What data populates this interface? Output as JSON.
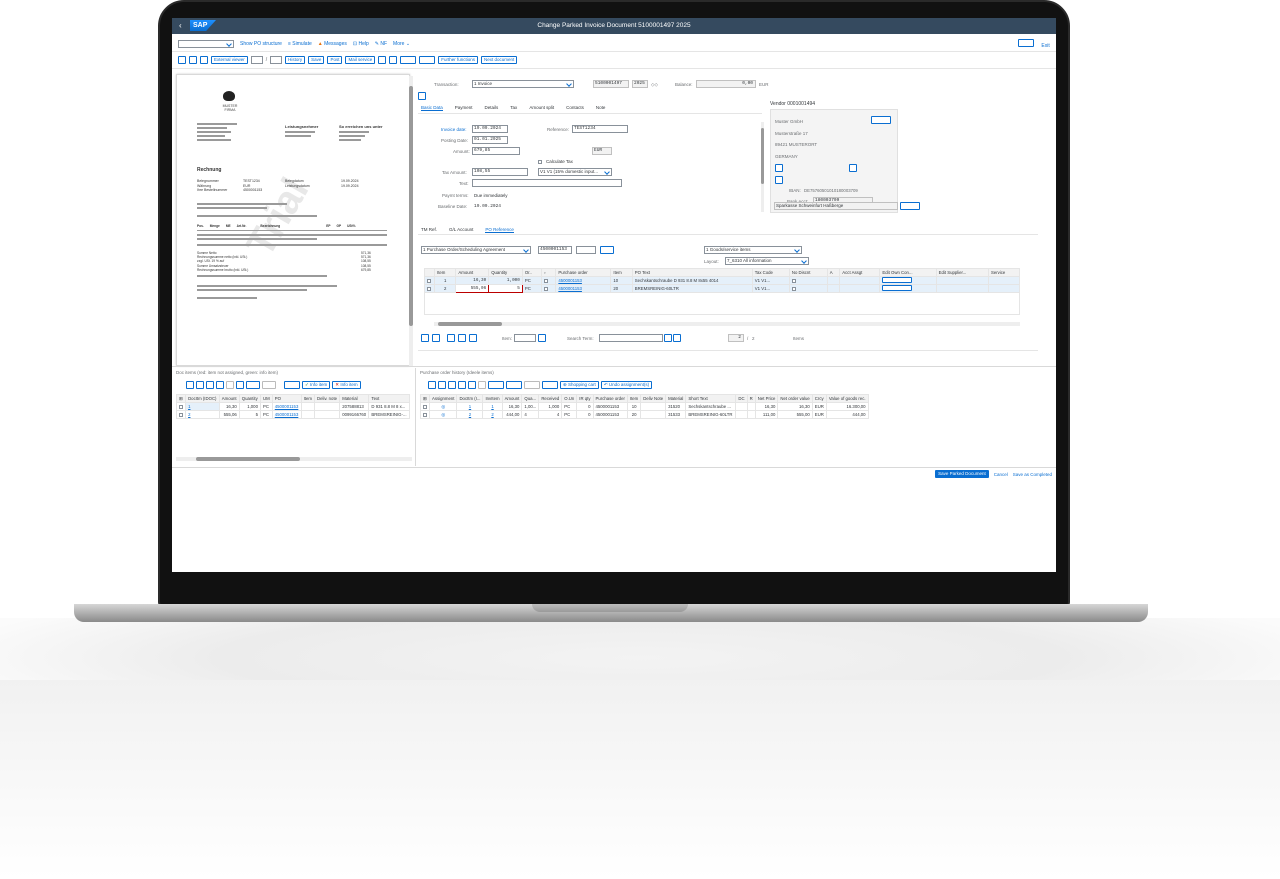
{
  "window": {
    "title": "Change Parked Invoice Document 5100001497 2025",
    "logo": "SAP",
    "exit_label": "Exit"
  },
  "toolbar1": {
    "show_po_structure": "Show PO structure",
    "simulate": "Simulate",
    "messages": "Messages",
    "help": "Help",
    "nf": "NF",
    "more": "More"
  },
  "toolbar2": {
    "external_viewer": "External viewer",
    "history": "History",
    "save": "Save",
    "post": "Post",
    "mail_service": "Mail service",
    "further_functions": "Further functions",
    "next_document": "Next document"
  },
  "pdf": {
    "company_line1": "MUSTER",
    "company_line2": "FIRMA",
    "watermark": "Trial",
    "heading": "Rechnung",
    "recipient_head": "Leistungsnehmer",
    "address_head": "So erreichen uns unter",
    "meta_labels": [
      "Belegnummer",
      "Währung",
      "Ihre Bestellnummer"
    ],
    "meta_values": [
      "TEST1234",
      "EUR",
      "4500001153"
    ],
    "date_labels": [
      "Belegdatum",
      "Leistungsdatum"
    ],
    "date_values": [
      "19.09.2024",
      "19.09.2024"
    ],
    "table_head": [
      "Pos.",
      "Menge",
      "ME",
      "Art.Nr.",
      "Bezeichnung",
      "EP",
      "GP",
      "USt%"
    ],
    "sum_rows": [
      "Summe Netto",
      "Rechnungssumme netto (inkl. USt.)",
      "zzgl. USt. 19 % auf",
      "Summe Umsatzsteuer",
      "Rechnungssumme brutto (inkl. USt.)"
    ],
    "sum_values": [
      "571,36",
      "571,36",
      "108,55",
      "108,55",
      "679,85"
    ]
  },
  "header": {
    "transaction_label": "Transaction:",
    "transaction_value": "1 Invoice",
    "doc_number": "5100001497",
    "doc_year": "2025",
    "balance_label": "Balance:",
    "balance_value": "0,00",
    "balance_currency": "EUR"
  },
  "tabs": [
    "Basic Data",
    "Payment",
    "Details",
    "Tax",
    "Amount split",
    "Contacts",
    "Note"
  ],
  "basic": {
    "invoice_date_label": "Invoice date:",
    "invoice_date": "19.09.2024",
    "reference_label": "Reference:",
    "reference": "TEST1234",
    "posting_date_label": "Posting Date:",
    "posting_date": "01.01.2025",
    "amount_label": "Amount:",
    "amount": "679,85",
    "currency": "EUR",
    "calculate_tax": "Calculate Tax",
    "tax_amount_label": "Tax Amount:",
    "tax_amount": "108,55",
    "tax_code": "V1 V1 (15% domestic input...",
    "text_label": "Text:",
    "paymt_terms_label": "Paymt terms:",
    "paymt_terms": "Due immediately",
    "baseline_date_label": "Baseline Date:",
    "baseline_date": "19.09.2024"
  },
  "vendor": {
    "title": "Vendor 0001001494",
    "name": "Muster GmbH",
    "street": "Musterstraße 17",
    "city": "89421 MUSTERORT",
    "country": "GERMANY",
    "iban_label": "IBAN:",
    "iban": "DE75760501010180003709",
    "bank_acct_label": "Bank Acct:",
    "bank_acct": "180003709",
    "bank": "Sparkasse Schweinfurt Haßberge"
  },
  "ref_tabs": [
    "TM Ref.",
    "G/L Account",
    "PO Reference"
  ],
  "po_ref": {
    "ref_type": "1 Purchase Order/Scheduling Agreement",
    "po_number": "4500001153",
    "item_type": "1 Goods/service items",
    "layout_label": "Layout:",
    "layout": "7_6310 All information",
    "columns": [
      "Item",
      "Amount",
      "Quantity",
      "Or..",
      "",
      "Purchase order",
      "Item",
      "PO Text",
      "Tax Code",
      "No Discnt",
      "A",
      "Acct Assgt",
      "Edit Own Con...",
      "Edit Supplier...",
      "Service"
    ],
    "rows": [
      {
        "item": "1",
        "amount": "16,30",
        "quantity": "1,000",
        "unit": "PC",
        "po": "4500001153",
        "po_item": "10",
        "text": "Sechskantschraube D 931 8.8 M 8x55 4014",
        "tax": "V1 V1..."
      },
      {
        "item": "2",
        "amount": "555,06",
        "quantity": "5",
        "unit": "PC",
        "po": "4500001153",
        "po_item": "20",
        "text": "BREMSREINIG-60LTR",
        "tax": "V1 V1..."
      }
    ],
    "item_label": "Item:",
    "search_label": "Search Term:",
    "page_current": "2",
    "page_sep": "/",
    "page_total": "2",
    "items_label": "Items"
  },
  "doc_items": {
    "title": "Doc items (red: item not assigned, green: info item)",
    "info_item": "Info item",
    "info_item2": "Info item",
    "columns": [
      "DocItm (IDOC)",
      "Amount",
      "Quantity",
      "UM",
      "PO",
      "Item",
      "Deliv. note",
      "Material",
      "Text"
    ],
    "rows": [
      [
        "1",
        "16,30",
        "1,000",
        "PC",
        "4500001153",
        "",
        "",
        "207588813",
        "D 931 8.8 M 8 x..."
      ],
      [
        "2",
        "555,06",
        "5",
        "PC",
        "4500001153",
        "",
        "",
        "0099166760",
        "BREMSREINIG-..."
      ]
    ]
  },
  "po_history": {
    "title": "Purchase order history (Ideele items)",
    "shopping_cart": "Shopping cart",
    "undo_assignment": "Undo assignment(s)",
    "columns": [
      "Assignment",
      "DocItm (I...",
      "InvItem",
      "Amount",
      "Qua...",
      "Received",
      "O.Un",
      "IR qty",
      "Purchase order",
      "Item",
      "Deliv Note",
      "Material",
      "Short Text",
      "DC",
      "R",
      "Net Price",
      "Net order value",
      "Crcy",
      "Value of goods rec."
    ],
    "rows": [
      [
        "",
        "1",
        "1",
        "16,30",
        "1,00...",
        "1,000",
        "PC",
        "0",
        "4500001153",
        "10",
        "",
        "31520",
        "Sechskantschraube ...",
        "",
        "",
        "16,30",
        "16,30",
        "EUR",
        "16.300,00"
      ],
      [
        "",
        "2",
        "2",
        "444,00",
        "4",
        "4",
        "PC",
        "0",
        "4500001153",
        "20",
        "",
        "31533",
        "BREMSREINIG-60LTR",
        "",
        "",
        "111,00",
        "555,00",
        "EUR",
        "444,00"
      ]
    ]
  },
  "footer": {
    "save_parked": "Save Parked Document",
    "cancel": "Cancel",
    "save_completed": "Save as Completed"
  }
}
